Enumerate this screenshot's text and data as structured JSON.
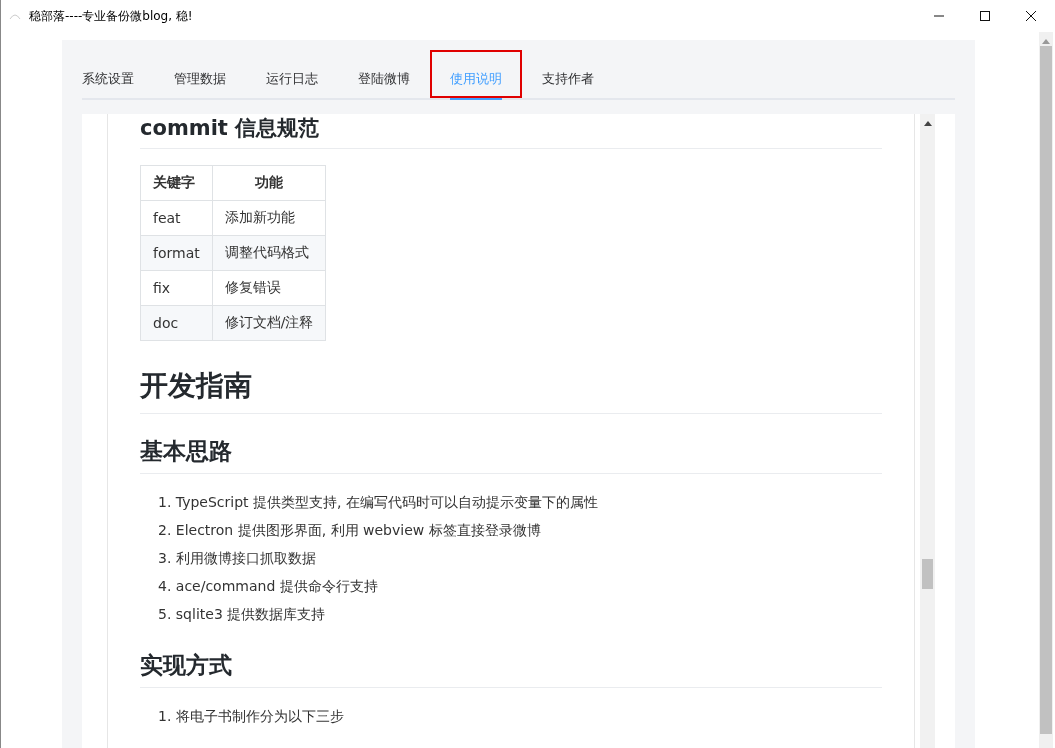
{
  "window": {
    "title": "稳部落----专业备份微blog, 稳!"
  },
  "tabs": [
    {
      "label": "系统设置",
      "selected": false,
      "highlighted": false
    },
    {
      "label": "管理数据",
      "selected": false,
      "highlighted": false
    },
    {
      "label": "运行日志",
      "selected": false,
      "highlighted": false
    },
    {
      "label": "登陆微博",
      "selected": false,
      "highlighted": false
    },
    {
      "label": "使用说明",
      "selected": true,
      "highlighted": true
    },
    {
      "label": "支持作者",
      "selected": false,
      "highlighted": false
    }
  ],
  "document": [
    {
      "kind": "h3",
      "text": "commit 信息规范"
    },
    {
      "kind": "table",
      "columns": [
        "关键字",
        "功能"
      ],
      "rows": [
        [
          "feat",
          "添加新功能"
        ],
        [
          "format",
          "调整代码格式"
        ],
        [
          "fix",
          "修复错误"
        ],
        [
          "doc",
          "修订文档/注释"
        ]
      ]
    },
    {
      "kind": "h1",
      "text": "开发指南"
    },
    {
      "kind": "h2",
      "text": "基本思路"
    },
    {
      "kind": "list",
      "items": [
        {
          "num": "1.",
          "text": "TypeScript 提供类型支持, 在编写代码时可以自动提示变量下的属性"
        },
        {
          "num": "2.",
          "text": "Electron 提供图形界面, 利用 webview 标签直接登录微博"
        },
        {
          "num": "3.",
          "text": "利用微博接口抓取数据"
        },
        {
          "num": "4.",
          "text": "ace/command 提供命令行支持"
        },
        {
          "num": "5.",
          "text": "sqlite3 提供数据库支持"
        }
      ]
    },
    {
      "kind": "h2",
      "text": "实现方式"
    },
    {
      "kind": "list",
      "items": [
        {
          "num": "1.",
          "text": "将电子书制作分为以下三步"
        }
      ]
    }
  ]
}
